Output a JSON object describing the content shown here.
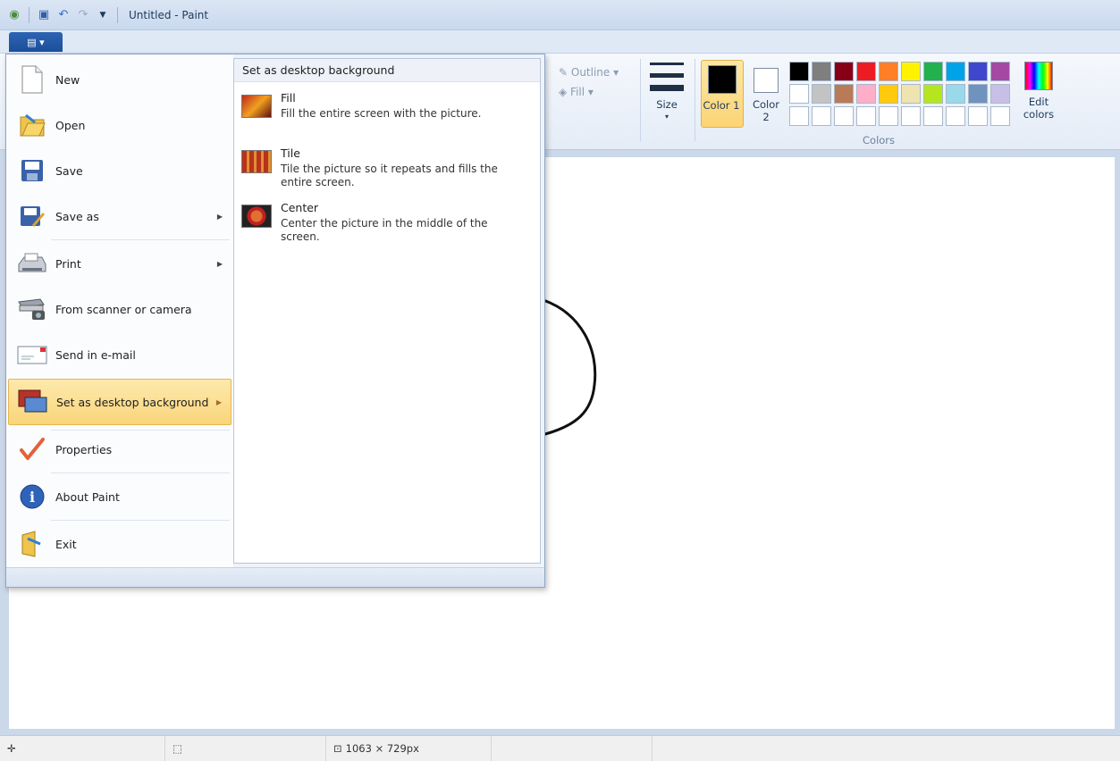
{
  "window": {
    "title": "Untitled - Paint"
  },
  "quick_access": {
    "icons": [
      "paint-app-icon",
      "save-icon",
      "undo-icon",
      "redo-icon",
      "customize-arrow-icon"
    ]
  },
  "ribbon": {
    "outline_label": "Outline",
    "fill_label": "Fill",
    "size_label": "Size",
    "color1_label": "Color 1",
    "color2_label": "Color 2",
    "edit_colors_label": "Edit colors",
    "colors_group_label": "Colors",
    "color1_value": "#000000",
    "color2_value": "#ffffff",
    "palette_row1": [
      "#000000",
      "#7f7f7f",
      "#880015",
      "#ed1c24",
      "#ff7f27",
      "#fff200",
      "#22b14c",
      "#00a2e8",
      "#3f48cc",
      "#a349a4"
    ],
    "palette_row2": [
      "#ffffff",
      "#c3c3c3",
      "#b97a57",
      "#ffaec9",
      "#ffc90e",
      "#efe4b0",
      "#b5e61d",
      "#99d9ea",
      "#7092be",
      "#c8bfe7"
    ]
  },
  "app_menu": {
    "items": [
      {
        "label": "New",
        "icon": "new-file-icon"
      },
      {
        "label": "Open",
        "icon": "open-folder-icon"
      },
      {
        "label": "Save",
        "icon": "save-icon"
      },
      {
        "label": "Save as",
        "icon": "save-as-icon"
      },
      {
        "label": "Print",
        "icon": "printer-icon"
      },
      {
        "label": "From scanner or camera",
        "icon": "scanner-icon"
      },
      {
        "label": "Send in e-mail",
        "icon": "email-icon"
      },
      {
        "label": "Set as desktop background",
        "icon": "desktop-background-icon"
      },
      {
        "label": "Properties",
        "icon": "checkmark-icon"
      },
      {
        "label": "About Paint",
        "icon": "info-icon"
      },
      {
        "label": "Exit",
        "icon": "exit-icon"
      }
    ],
    "submenu": {
      "header": "Set as desktop background",
      "options": [
        {
          "title": "Fill",
          "desc": "Fill the entire screen with the picture."
        },
        {
          "title": "Tile",
          "desc": "Tile the picture so it repeats and fills the entire screen."
        },
        {
          "title": "Center",
          "desc": "Center the picture in the middle of the screen."
        }
      ]
    }
  },
  "status": {
    "dimensions": "1063 × 729px"
  }
}
